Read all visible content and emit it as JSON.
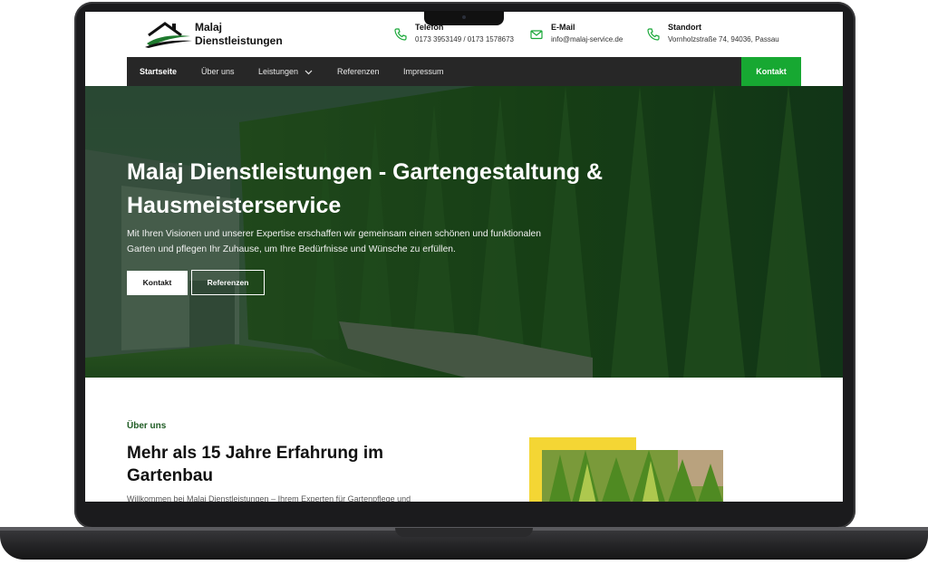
{
  "header": {
    "brand": {
      "line1": "Malaj",
      "line2": "Dienstleistungen"
    },
    "contacts": [
      {
        "icon": "phone-icon",
        "title": "Telefon",
        "value": "0173 3953149 / 0173 1578673"
      },
      {
        "icon": "mail-icon",
        "title": "E-Mail",
        "value": "info@malaj-service.de"
      },
      {
        "icon": "phone-icon",
        "title": "Standort",
        "value": "Vornholzstraße 74, 94036, Passau"
      }
    ]
  },
  "nav": {
    "items": [
      {
        "label": "Startseite",
        "active": true
      },
      {
        "label": "Über uns"
      },
      {
        "label": "Leistungen",
        "has_dropdown": true
      },
      {
        "label": "Referenzen"
      },
      {
        "label": "Impressum"
      }
    ],
    "cta": "Kontakt"
  },
  "hero": {
    "title": "Malaj Dienstleistungen - Gartengestaltung & Hausmeisterservice",
    "text": "Mit Ihren Visionen und unserer Expertise erschaffen wir gemeinsam einen schönen und funktionalen Garten und pflegen Ihr Zuhause, um Ihre Bedürfnisse und Wünsche zu erfüllen.",
    "primary_button": "Kontakt",
    "secondary_button": "Referenzen"
  },
  "about": {
    "kicker": "Über uns",
    "title": "Mehr als 15 Jahre Erfahrung im Gartenbau",
    "text": "Willkommen bei Malaj Dienstleistungen – Ihrem Experten für Gartenpflege und"
  },
  "colors": {
    "accent_green": "#17a832",
    "nav_bg": "#272727",
    "kicker_green": "#1f5c24",
    "yellow": "#f4d634"
  }
}
